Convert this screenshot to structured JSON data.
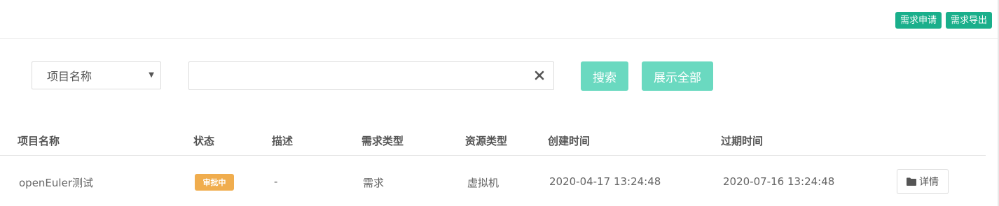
{
  "toolbar": {
    "request_apply_label": "需求申请",
    "request_export_label": "需求导出",
    "button_color": "#1aaf8b"
  },
  "search": {
    "field_select_value": "项目名称",
    "input_value": "",
    "search_label": "搜索",
    "show_all_label": "展示全部",
    "button_color": "#6ad9c0"
  },
  "table": {
    "headers": [
      "项目名称",
      "状态",
      "描述",
      "需求类型",
      "资源类型",
      "创建时间",
      "过期时间"
    ],
    "rows": [
      {
        "project_name": "openEuler测试",
        "status": "审批中",
        "status_color": "#f0ad4e",
        "description": "-",
        "request_type": "需求",
        "resource_type": "虚拟机",
        "created_at": "2020-04-17 13:24:48",
        "expires_at": "2020-07-16 13:24:48",
        "action_label": "详情"
      }
    ]
  },
  "icons": [
    "dropdown-caret-icon",
    "clear-icon",
    "folder-icon"
  ]
}
